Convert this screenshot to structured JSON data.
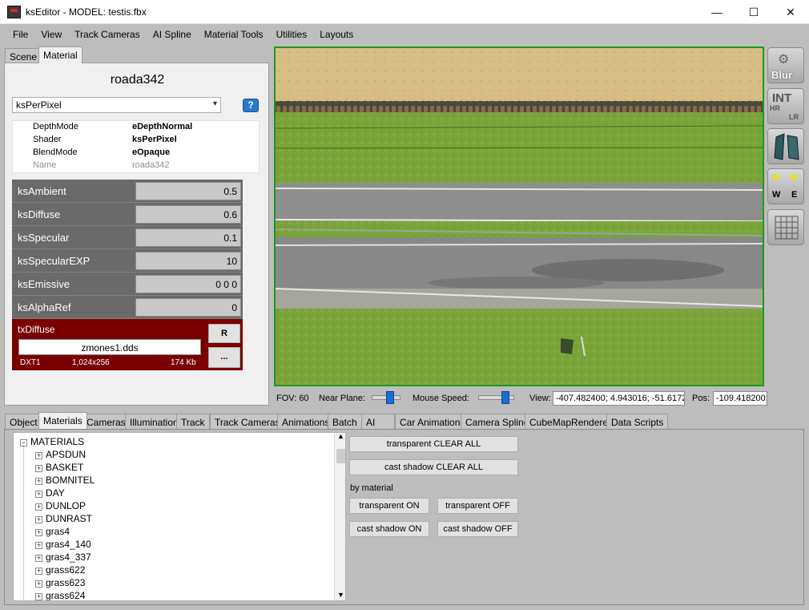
{
  "window": {
    "title": "ksEditor - MODEL: testis.fbx",
    "controls": {
      "minimize": "—",
      "maximize": "☐",
      "close": "✕"
    }
  },
  "menu": [
    "File",
    "View",
    "Track Cameras",
    "AI Spline",
    "Material Tools",
    "Utilities",
    "Layouts"
  ],
  "top_tabs": [
    "Scene",
    "Material"
  ],
  "material": {
    "name": "roada342",
    "shader_select": "ksPerPixel",
    "properties": [
      {
        "key": "DepthMode",
        "value": "eDepthNormal"
      },
      {
        "key": "Shader",
        "value": "ksPerPixel"
      },
      {
        "key": "BlendMode",
        "value": "eOpaque"
      },
      {
        "key": "Name",
        "value": "roada342"
      }
    ],
    "params": [
      {
        "label": "ksAmbient",
        "value": "0.5"
      },
      {
        "label": "ksDiffuse",
        "value": "0.6"
      },
      {
        "label": "ksSpecular",
        "value": "0.1"
      },
      {
        "label": "ksSpecularEXP",
        "value": "10"
      },
      {
        "label": "ksEmissive",
        "value": "0 0 0"
      },
      {
        "label": "ksAlphaRef",
        "value": "0"
      }
    ],
    "texture": {
      "slot": "txDiffuse",
      "file": "zmones1.dds",
      "format": "DXT1",
      "dimensions": "1,024x256",
      "size": "174 Kb",
      "reload_label": "R",
      "browse_label": "..."
    }
  },
  "toolbar": {
    "blur": "Blur",
    "int": "INT",
    "hr": "HR",
    "lr": "LR",
    "w": "W",
    "e": "E"
  },
  "status": {
    "fov": "FOV: 60",
    "near_plane_label": "Near Plane:",
    "near_plane_level": 0.7,
    "mouse_speed_label": "Mouse Speed:",
    "mouse_speed_level": 0.85,
    "view_label": "View:",
    "view_value": "-407.482400; 4.943016; -51.6172",
    "pos_label": "Pos:",
    "pos_value": "-109.418200;"
  },
  "bottom_tabs": [
    "Object",
    "Materials",
    "Cameras",
    "Illumination",
    "Track",
    "Track Cameras",
    "Animations",
    "Batch",
    "AI",
    "Car Animations",
    "Camera Spline",
    "CubeMapRenderer",
    "Data Scripts"
  ],
  "tree": {
    "root": "MATERIALS",
    "items": [
      "APSDUN",
      "BASKET",
      "BOMNITEL",
      "DAY",
      "DUNLOP",
      "DUNRAST",
      "gras4",
      "gras4_140",
      "gras4_337",
      "grass622",
      "grass623",
      "grass624"
    ]
  },
  "actions": {
    "transparent_clear_all": "transparent CLEAR ALL",
    "cast_shadow_clear_all": "cast shadow CLEAR ALL",
    "by_material": "by material",
    "transparent_on": "transparent ON",
    "transparent_off": "transparent OFF",
    "cast_shadow_on": "cast shadow ON",
    "cast_shadow_off": "cast shadow OFF"
  }
}
